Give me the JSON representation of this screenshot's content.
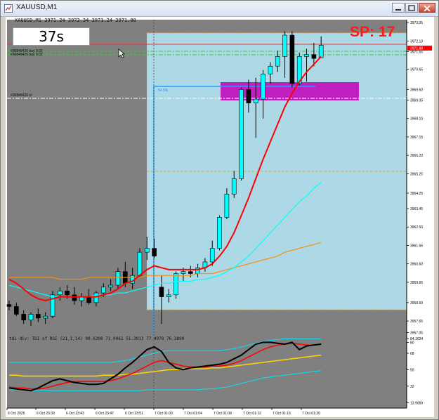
{
  "window": {
    "title": "XAUUSD,M1"
  },
  "chart_info": {
    "header": "XAUUSD,M1  3971.24 3972.34 3971.24 3971.88"
  },
  "countdown": {
    "label": "37s"
  },
  "spread": {
    "label": "SP: 17"
  },
  "orders": {
    "row1": "#36849426 buy 0.02",
    "row2": "#36849425 buy 0.02",
    "row3": "#36849426 sl",
    "box": "54.5%"
  },
  "current_price": {
    "label": "3971.88",
    "bg": "#ff0000"
  },
  "indicator": {
    "header": "tdi div: TDI of RSI (21,1,14) 90.6208 71.0061 51.3913 77.4978 76.3890"
  },
  "colors": {
    "chart_bg": "#808080",
    "box": "#add8e6",
    "zone": "#c020c0",
    "bull": "#00ffff",
    "bear": "#000000"
  },
  "chart_data": {
    "type": "candlestick",
    "symbol": "XAUUSD",
    "timeframe": "M1",
    "price_axis": [
      "3973.05",
      "3972.10",
      "3971.55",
      "3970.65",
      "3969.60",
      "3969.05",
      "3968.10",
      "3967.15",
      "3966.20",
      "3965.25",
      "3964.25",
      "3963.45",
      "3962.50",
      "3961.55",
      "3960.60",
      "3959.65",
      "3958.60",
      "3957.65",
      "3957.05"
    ],
    "time_axis": [
      "6 Oct 2025",
      "6 Oct 23:39",
      "6 Oct 23:43",
      "6 Oct 23:47",
      "6 Oct 23:51",
      "7 Oct 01:00",
      "7 Oct 01:04",
      "7 Oct 01:08",
      "7 Oct 01:12",
      "7 Oct 01:16",
      "7 Oct 01:20"
    ],
    "indicator_axis": [
      "84.1024",
      "80",
      "68",
      "50",
      "32",
      "13.9069"
    ],
    "ylim": [
      3957.0,
      3973.2
    ],
    "current_price": 3971.88,
    "candles": [
      {
        "o": 3958.5,
        "h": 3958.7,
        "l": 3958.2,
        "c": 3958.4
      },
      {
        "o": 3958.4,
        "h": 3958.6,
        "l": 3957.9,
        "c": 3958.0
      },
      {
        "o": 3958.0,
        "h": 3958.2,
        "l": 3957.5,
        "c": 3957.7
      },
      {
        "o": 3957.7,
        "h": 3958.1,
        "l": 3957.4,
        "c": 3958.0
      },
      {
        "o": 3958.0,
        "h": 3958.3,
        "l": 3957.6,
        "c": 3957.8
      },
      {
        "o": 3957.8,
        "h": 3958.1,
        "l": 3957.5,
        "c": 3957.9
      },
      {
        "o": 3957.9,
        "h": 3959.2,
        "l": 3957.8,
        "c": 3959.0
      },
      {
        "o": 3959.0,
        "h": 3959.4,
        "l": 3958.7,
        "c": 3959.2
      },
      {
        "o": 3959.2,
        "h": 3959.5,
        "l": 3958.8,
        "c": 3959.0
      },
      {
        "o": 3959.0,
        "h": 3959.4,
        "l": 3958.5,
        "c": 3958.7
      },
      {
        "o": 3958.7,
        "h": 3959.1,
        "l": 3958.4,
        "c": 3958.9
      },
      {
        "o": 3958.9,
        "h": 3959.3,
        "l": 3958.5,
        "c": 3958.6
      },
      {
        "o": 3958.6,
        "h": 3959.2,
        "l": 3958.4,
        "c": 3959.1
      },
      {
        "o": 3959.1,
        "h": 3959.6,
        "l": 3958.9,
        "c": 3959.4
      },
      {
        "o": 3959.4,
        "h": 3959.8,
        "l": 3959.2,
        "c": 3959.5
      },
      {
        "o": 3959.5,
        "h": 3960.4,
        "l": 3959.3,
        "c": 3960.2
      },
      {
        "o": 3960.2,
        "h": 3960.7,
        "l": 3959.4,
        "c": 3959.6
      },
      {
        "o": 3959.6,
        "h": 3960.4,
        "l": 3959.3,
        "c": 3960.0
      },
      {
        "o": 3960.0,
        "h": 3961.4,
        "l": 3959.9,
        "c": 3961.2
      },
      {
        "o": 3961.2,
        "h": 3962.0,
        "l": 3960.8,
        "c": 3961.4
      },
      {
        "o": 3961.4,
        "h": 3961.9,
        "l": 3960.9,
        "c": 3961.0
      },
      {
        "o": 3959.4,
        "h": 3960.0,
        "l": 3957.5,
        "c": 3958.9
      },
      {
        "o": 3958.9,
        "h": 3959.3,
        "l": 3958.6,
        "c": 3959.0
      },
      {
        "o": 3959.0,
        "h": 3960.2,
        "l": 3958.8,
        "c": 3960.1
      },
      {
        "o": 3960.1,
        "h": 3960.4,
        "l": 3959.7,
        "c": 3960.2
      },
      {
        "o": 3960.2,
        "h": 3960.5,
        "l": 3959.9,
        "c": 3960.1
      },
      {
        "o": 3960.1,
        "h": 3960.6,
        "l": 3959.9,
        "c": 3960.4
      },
      {
        "o": 3960.4,
        "h": 3960.9,
        "l": 3960.2,
        "c": 3960.7
      },
      {
        "o": 3960.7,
        "h": 3961.8,
        "l": 3960.5,
        "c": 3961.4
      },
      {
        "o": 3961.4,
        "h": 3963.1,
        "l": 3961.3,
        "c": 3963.0
      },
      {
        "o": 3963.0,
        "h": 3964.5,
        "l": 3962.9,
        "c": 3964.2
      },
      {
        "o": 3964.2,
        "h": 3965.4,
        "l": 3964.0,
        "c": 3965.0
      },
      {
        "o": 3965.0,
        "h": 3969.7,
        "l": 3964.9,
        "c": 3969.6
      },
      {
        "o": 3969.6,
        "h": 3970.1,
        "l": 3968.4,
        "c": 3968.9
      },
      {
        "o": 3968.9,
        "h": 3970.2,
        "l": 3967.1,
        "c": 3969.1
      },
      {
        "o": 3969.1,
        "h": 3970.6,
        "l": 3968.1,
        "c": 3970.4
      },
      {
        "o": 3970.4,
        "h": 3971.0,
        "l": 3969.9,
        "c": 3970.8
      },
      {
        "o": 3970.8,
        "h": 3971.6,
        "l": 3970.5,
        "c": 3971.3
      },
      {
        "o": 3971.3,
        "h": 3972.6,
        "l": 3970.2,
        "c": 3972.4
      },
      {
        "o": 3972.4,
        "h": 3972.6,
        "l": 3969.7,
        "c": 3969.9
      },
      {
        "o": 3969.9,
        "h": 3971.5,
        "l": 3969.8,
        "c": 3971.3
      },
      {
        "o": 3971.3,
        "h": 3971.7,
        "l": 3970.0,
        "c": 3971.4
      },
      {
        "o": 3971.4,
        "h": 3972.0,
        "l": 3970.8,
        "c": 3971.2
      },
      {
        "o": 3971.24,
        "h": 3972.34,
        "l": 3971.24,
        "c": 3971.88
      }
    ],
    "ma_red": [
      3959.8,
      3959.6,
      3959.3,
      3959.0,
      3958.8,
      3958.7,
      3958.8,
      3958.9,
      3958.9,
      3958.9,
      3958.9,
      3958.9,
      3958.9,
      3959.0,
      3959.1,
      3959.3,
      3959.6,
      3959.7,
      3960.0,
      3960.3,
      3960.5,
      3960.4,
      3960.3,
      3960.3,
      3960.3,
      3960.3,
      3960.3,
      3960.4,
      3960.6,
      3961.0,
      3961.5,
      3962.2,
      3963.1,
      3964.0,
      3965.0,
      3966.0,
      3966.9,
      3967.8,
      3968.7,
      3969.4,
      3970.0,
      3970.5,
      3970.9,
      3971.3
    ],
    "ma_cyan": [
      3959.5,
      3959.4,
      3959.3,
      3959.2,
      3959.1,
      3959.0,
      3958.9,
      3958.9,
      3958.9,
      3958.9,
      3958.9,
      3958.9,
      3959.0,
      3959.0,
      3959.0,
      3959.1,
      3959.1,
      3959.2,
      3959.3,
      3959.4,
      3959.5,
      3959.6,
      3959.6,
      3959.7,
      3959.7,
      3959.7,
      3959.8,
      3959.8,
      3959.9,
      3960.0,
      3960.2,
      3960.4,
      3960.7,
      3961.0,
      3961.4,
      3961.8,
      3962.2,
      3962.6,
      3963.0,
      3963.4,
      3963.8,
      3964.1,
      3964.5,
      3964.8
    ],
    "ma_orange": [
      3959.9,
      3959.9,
      3959.9,
      3959.9,
      3959.9,
      3959.9,
      3959.9,
      3959.8,
      3959.8,
      3959.8,
      3959.8,
      3959.9,
      3959.9,
      3959.9,
      3959.9,
      3959.9,
      3959.9,
      3959.9,
      3959.9,
      3960.0,
      3960.0,
      3960.0,
      3960.0,
      3960.0,
      3960.0,
      3960.0,
      3960.1,
      3960.1,
      3960.1,
      3960.2,
      3960.3,
      3960.4,
      3960.5,
      3960.6,
      3960.7,
      3960.8,
      3960.9,
      3961.0,
      3961.2,
      3961.3,
      3961.4,
      3961.5,
      3961.6,
      3961.7
    ],
    "tdi_black": [
      30,
      29,
      28,
      27,
      30,
      34,
      38,
      40,
      38,
      36,
      35,
      34,
      34,
      35,
      40,
      45,
      52,
      58,
      65,
      72,
      75,
      70,
      58,
      52,
      50,
      52,
      53,
      54,
      55,
      56,
      58,
      62,
      66,
      72,
      78,
      80,
      80,
      79,
      78,
      80,
      72,
      76,
      77,
      78
    ],
    "tdi_red": [
      31,
      30,
      30,
      29,
      29,
      30,
      32,
      34,
      36,
      37,
      37,
      37,
      37,
      37,
      38,
      40,
      43,
      46,
      50,
      54,
      58,
      60,
      58,
      56,
      54,
      53,
      53,
      53,
      54,
      54,
      55,
      57,
      60,
      64,
      68,
      72,
      75,
      77,
      78,
      79,
      78,
      77,
      77,
      78
    ],
    "tdi_yellow": [
      44,
      44,
      43,
      43,
      43,
      43,
      43,
      43,
      43,
      43,
      43,
      43,
      43,
      44,
      44,
      44,
      45,
      45,
      46,
      47,
      48,
      49,
      50,
      50,
      51,
      51,
      51,
      51,
      52,
      52,
      53,
      54,
      55,
      56,
      57,
      58,
      59,
      60,
      61,
      62,
      63,
      64,
      65,
      66
    ],
    "tdi_cyan_upper": [
      58,
      58,
      58,
      58,
      58,
      58,
      58,
      58,
      58,
      58,
      58,
      58,
      58,
      58,
      58,
      59,
      60,
      62,
      64,
      66,
      68,
      70,
      71,
      71,
      71,
      71,
      71,
      71,
      71,
      71,
      72,
      73,
      75,
      77,
      79,
      81,
      82,
      83,
      84,
      84,
      84,
      84,
      84,
      84
    ],
    "tdi_cyan_lower": [
      28,
      28,
      28,
      27,
      27,
      27,
      27,
      27,
      27,
      27,
      27,
      27,
      27,
      27,
      27,
      27,
      27,
      27,
      27,
      28,
      28,
      28,
      28,
      28,
      28,
      28,
      28,
      29,
      29,
      30,
      31,
      33,
      35,
      37,
      39,
      41,
      42,
      43,
      44,
      45,
      46,
      47,
      48,
      49
    ]
  }
}
